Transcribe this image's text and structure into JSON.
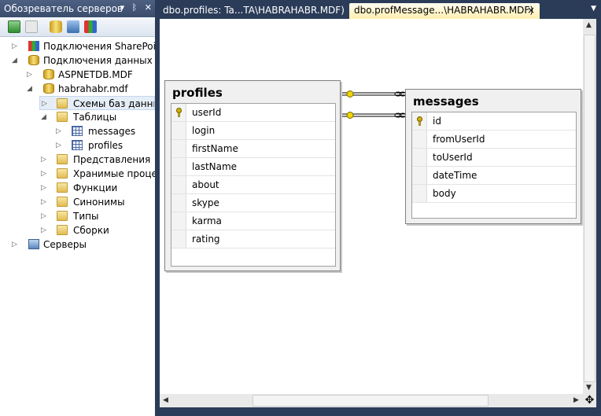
{
  "explorer": {
    "title": "Обозреватель серверов",
    "pin_icon": "pin-icon",
    "close_icon": "close-icon",
    "tree": [
      {
        "label": "Подключения SharePoint",
        "icon": "sharepoint-icon"
      },
      {
        "label": "Подключения данных",
        "icon": "data-connections-icon"
      },
      {
        "label": "ASPNETDB.MDF",
        "icon": "database-icon"
      },
      {
        "label": "habrahabr.mdf",
        "icon": "database-icon"
      },
      {
        "label": "Схемы баз данных",
        "icon": "folder-icon"
      },
      {
        "label": "Таблицы",
        "icon": "folder-icon"
      },
      {
        "label": "messages",
        "icon": "table-icon"
      },
      {
        "label": "profiles",
        "icon": "table-icon"
      },
      {
        "label": "Представления",
        "icon": "folder-icon"
      },
      {
        "label": "Хранимые процеду",
        "icon": "folder-icon"
      },
      {
        "label": "Функции",
        "icon": "folder-icon"
      },
      {
        "label": "Синонимы",
        "icon": "folder-icon"
      },
      {
        "label": "Типы",
        "icon": "folder-icon"
      },
      {
        "label": "Сборки",
        "icon": "folder-icon"
      },
      {
        "label": "Серверы",
        "icon": "servers-icon"
      }
    ]
  },
  "tabs": [
    {
      "label": "dbo.profiles: Ta...TA\\HABRAHABR.MDF)"
    },
    {
      "label": "dbo.profMessage...\\HABRAHABR.MDF)"
    }
  ],
  "tab_close": "×",
  "tables": {
    "profiles": {
      "title": "profiles",
      "columns": [
        "userId",
        "login",
        "firstName",
        "lastName",
        "about",
        "skype",
        "karma",
        "rating"
      ],
      "key_column": "userId"
    },
    "messages": {
      "title": "messages",
      "columns": [
        "id",
        "fromUserId",
        "toUserId",
        "dateTime",
        "body"
      ],
      "key_column": "id"
    }
  },
  "colors": {
    "chrome": "#2b3c59",
    "active_tab": "#ffefb0",
    "key": "#d4b000"
  }
}
